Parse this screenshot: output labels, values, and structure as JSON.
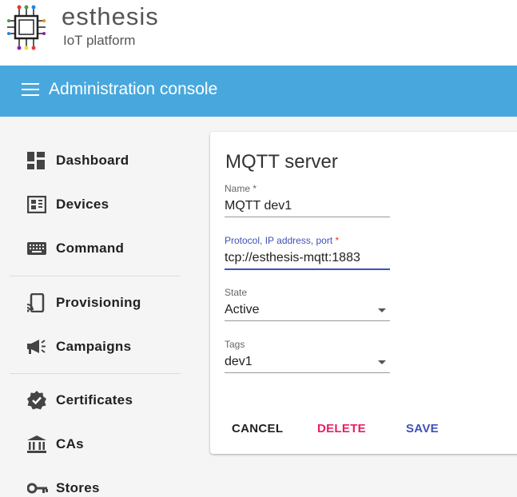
{
  "brand": {
    "name": "esthesis",
    "subtitle": "IoT platform"
  },
  "appbar": {
    "title": "Administration console"
  },
  "nav": {
    "dashboard": "Dashboard",
    "devices": "Devices",
    "command": "Command",
    "provisioning": "Provisioning",
    "campaigns": "Campaigns",
    "certificates": "Certificates",
    "cas": "CAs",
    "stores": "Stores"
  },
  "form": {
    "title": "MQTT server",
    "name": {
      "label": "Name",
      "value": "MQTT dev1"
    },
    "address": {
      "label": "Protocol, IP address, port",
      "value": "tcp://esthesis-mqtt:1883"
    },
    "state": {
      "label": "State",
      "value": "Active"
    },
    "tags": {
      "label": "Tags",
      "value": "dev1"
    },
    "required_mark": "*"
  },
  "buttons": {
    "cancel": "CANCEL",
    "delete": "DELETE",
    "save": "SAVE"
  },
  "colors": {
    "appbar": "#48a8de",
    "primary": "#3f51b5",
    "danger": "#e91e63"
  }
}
